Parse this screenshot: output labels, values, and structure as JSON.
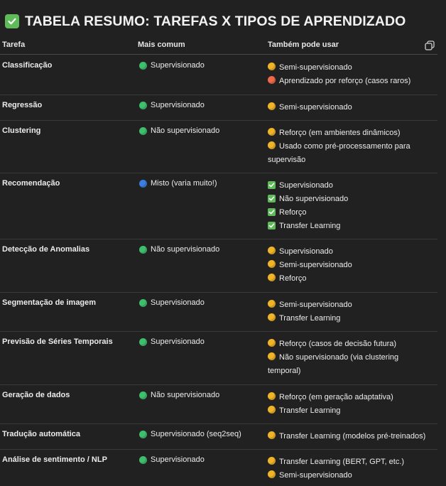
{
  "title": "TABELA RESUMO: TAREFAS X TIPOS DE APRENDIZADO",
  "headers": {
    "task": "Tarefa",
    "common": "Mais comum",
    "alt": "Também pode usar"
  },
  "colors": {
    "green": "#3fbf6e",
    "yellow": "#f0b429",
    "orange": "#f06a4a",
    "blue": "#3b7de0",
    "check": "#5fba5a"
  },
  "rows": [
    {
      "task": "Classificação",
      "common": {
        "icon": "green-circle-icon",
        "text": "Supervisionado"
      },
      "alt": [
        {
          "icon": "yellow-circle-icon",
          "text": "Semi-supervisionado"
        },
        {
          "icon": "orange-circle-icon",
          "text": "Aprendizado por reforço (casos raros)"
        }
      ]
    },
    {
      "task": "Regressão",
      "common": {
        "icon": "green-circle-icon",
        "text": "Supervisionado"
      },
      "alt": [
        {
          "icon": "yellow-circle-icon",
          "text": "Semi-supervisionado"
        }
      ]
    },
    {
      "task": "Clustering",
      "common": {
        "icon": "green-circle-icon",
        "text": "Não supervisionado"
      },
      "alt": [
        {
          "icon": "yellow-circle-icon",
          "text": "Reforço (em ambientes dinâmicos)"
        },
        {
          "icon": "yellow-circle-icon",
          "text": "Usado como pré-processamento para supervisão"
        }
      ]
    },
    {
      "task": "Recomendação",
      "common": {
        "icon": "blue-circle-icon",
        "text": "Misto (varia muito!)"
      },
      "alt": [
        {
          "icon": "check-box-icon",
          "text": "Supervisionado"
        },
        {
          "icon": "check-box-icon",
          "text": "Não supervisionado"
        },
        {
          "icon": "check-box-icon",
          "text": "Reforço"
        },
        {
          "icon": "check-box-icon",
          "text": "Transfer Learning"
        }
      ]
    },
    {
      "task": "Detecção de Anomalias",
      "common": {
        "icon": "green-circle-icon",
        "text": "Não supervisionado"
      },
      "alt": [
        {
          "icon": "yellow-circle-icon",
          "text": "Supervisionado"
        },
        {
          "icon": "yellow-circle-icon",
          "text": "Semi-supervisionado"
        },
        {
          "icon": "yellow-circle-icon",
          "text": "Reforço"
        }
      ]
    },
    {
      "task": "Segmentação de imagem",
      "common": {
        "icon": "green-circle-icon",
        "text": "Supervisionado"
      },
      "alt": [
        {
          "icon": "yellow-circle-icon",
          "text": "Semi-supervisionado"
        },
        {
          "icon": "yellow-circle-icon",
          "text": "Transfer Learning"
        }
      ]
    },
    {
      "task": "Previsão de Séries Temporais",
      "common": {
        "icon": "green-circle-icon",
        "text": "Supervisionado"
      },
      "alt": [
        {
          "icon": "yellow-circle-icon",
          "text": "Reforço (casos de decisão futura)"
        },
        {
          "icon": "yellow-circle-icon",
          "text": "Não supervisionado (via clustering temporal)"
        }
      ]
    },
    {
      "task": "Geração de dados",
      "common": {
        "icon": "green-circle-icon",
        "text": "Não supervisionado"
      },
      "alt": [
        {
          "icon": "yellow-circle-icon",
          "text": "Reforço (em geração adaptativa)"
        },
        {
          "icon": "yellow-circle-icon",
          "text": "Transfer Learning"
        }
      ]
    },
    {
      "task": "Tradução automática",
      "common": {
        "icon": "green-circle-icon",
        "text": "Supervisionado (seq2seq)"
      },
      "alt": [
        {
          "icon": "yellow-circle-icon",
          "text": "Transfer Learning (modelos pré-treinados)"
        }
      ]
    },
    {
      "task": "Análise de sentimento / NLP",
      "common": {
        "icon": "green-circle-icon",
        "text": "Supervisionado"
      },
      "alt": [
        {
          "icon": "yellow-circle-icon",
          "text": "Transfer Learning (BERT, GPT, etc.)"
        },
        {
          "icon": "yellow-circle-icon",
          "text": "Semi-supervisionado"
        }
      ]
    }
  ]
}
